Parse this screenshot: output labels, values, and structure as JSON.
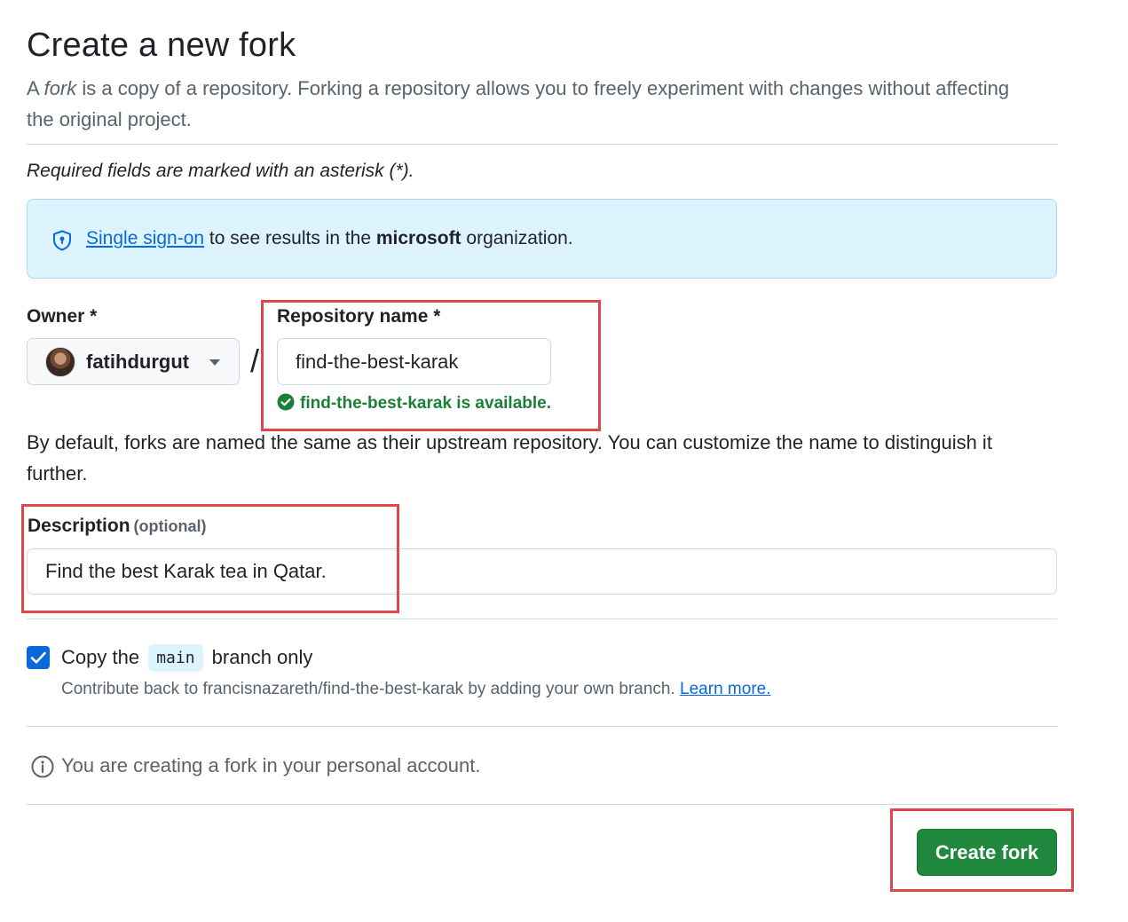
{
  "header": {
    "title": "Create a new fork",
    "subtitle_prefix": "A ",
    "subtitle_em": "fork",
    "subtitle_rest": " is a copy of a repository. Forking a repository allows you to freely experiment with changes without affecting the original project."
  },
  "form": {
    "required_note": "Required fields are marked with an asterisk (*).",
    "sso": {
      "link_text": "Single sign-on",
      "text_before_org": " to see results in the ",
      "org": "microsoft",
      "text_after_org": " organization."
    },
    "owner": {
      "label": "Owner *",
      "value": "fatihdurgut"
    },
    "separator": "/",
    "repo_name": {
      "label": "Repository name *",
      "value": "find-the-best-karak",
      "availability": "find-the-best-karak is available."
    },
    "naming_hint": "By default, forks are named the same as their upstream repository. You can customize the name to distinguish it further.",
    "description": {
      "label": "Description",
      "optional_label": "(optional)",
      "value": "Find the best Karak tea in Qatar."
    },
    "copy_branch": {
      "checked": true,
      "label_before": "Copy the",
      "branch": "main",
      "label_after": "branch only",
      "sub_text": "Contribute back to francisnazareth/find-the-best-karak by adding your own branch.",
      "learn_more": "Learn more."
    },
    "info_text": "You are creating a fork in your personal account.",
    "submit_label": "Create fork"
  },
  "colors": {
    "primary_button": "#1f883d",
    "link": "#0969da",
    "success": "#1a7f37",
    "banner_bg": "#ddf4ff",
    "annotation_box": "#e0474c"
  },
  "icons": {
    "sso": "shield-lock-icon",
    "availability": "check-circle-icon",
    "info": "info-icon",
    "dropdown": "chevron-down-icon",
    "checkbox": "checkmark-icon"
  }
}
